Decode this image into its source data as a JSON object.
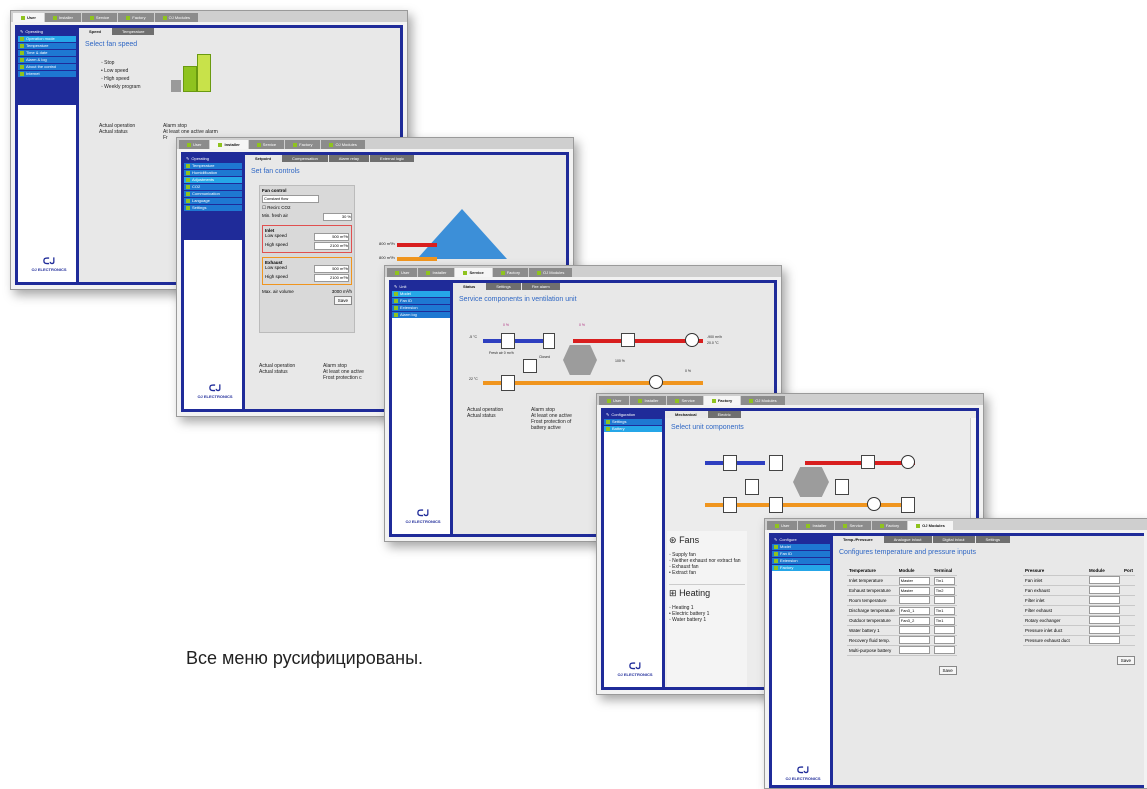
{
  "caption": "Все меню русифицированы.",
  "tabs": [
    "User",
    "Installer",
    "Service",
    "Factory",
    "OJ Modules"
  ],
  "logo": "OJ ELECTRONICS",
  "w1": {
    "side_header": "Operating",
    "side_items": [
      "Operation mode",
      "Temperature",
      "Time & date",
      "Alarm & log",
      "About the control",
      "Internet"
    ],
    "subtabs": [
      "Speed",
      "Temperature"
    ],
    "title": "Select fan speed",
    "options": [
      "Stop",
      "Low speed",
      "High speed",
      "Weekly program"
    ],
    "status_labels": [
      "Actual operation",
      "Actual status"
    ],
    "status_values": [
      "Alarm stop",
      "At least one active alarm",
      "Fr"
    ]
  },
  "w2": {
    "side_header": "Operating",
    "side_items": [
      "Temperature",
      "Humidification",
      "Adjustments",
      "CO2",
      "Communication",
      "Language",
      "Settings"
    ],
    "subtabs": [
      "Setpoint",
      "Compensation",
      "Alarm relay",
      "External logic"
    ],
    "title": "Set fan controls",
    "fan_control": "Fan control",
    "mode": "Constant flow",
    "recirc": "Recirc CO2",
    "min_fresh": "Min. fresh air",
    "min_fresh_val": "30 %",
    "inlet": "Inlet",
    "exhaust": "Exhaust",
    "low": "Low speed",
    "high": "High speed",
    "inlet_low": "500 m³/h",
    "inlet_high": "2100 m³/h",
    "exh_low": "500 m³/h",
    "exh_high": "2100 m³/h",
    "max_vol": "Max. air volume",
    "max_vol_val": "3000 m³/h",
    "save": "Save",
    "flow1": "800 m³/h",
    "flow2": "800 m³/h",
    "status_labels": [
      "Actual operation",
      "Actual status"
    ],
    "status_values": [
      "Alarm stop",
      "At least one active",
      "Frost protection c"
    ]
  },
  "w3": {
    "side_header": "Unit",
    "side_items": [
      "Model",
      "Fan ID",
      "Extension",
      "Alarm log"
    ],
    "subtabs": [
      "Status",
      "Settings",
      "Fire alarm"
    ],
    "title": "Service components in ventilation unit",
    "status_labels": [
      "Actual operation",
      "Actual status"
    ],
    "status_values": [
      "Alarm stop",
      "At least one active",
      "Frost protection of",
      "battery active"
    ],
    "labels": {
      "t1": "-5 °C",
      "t2": "22 °C",
      "pct1": "0 %",
      "pct2": "0 %",
      "pct3": "100 %",
      "pct4": "0 %",
      "fresh": "Fresh air 0 m³/h",
      "closed": "Closed",
      "outflow": "-900 m³/h",
      "outtemp": "20.0 °C"
    }
  },
  "w4": {
    "side_header": "Configuration",
    "side_items": [
      "Settings",
      "Battery"
    ],
    "subtabs": [
      "Mechanical",
      "Electric"
    ],
    "title": "Select unit components",
    "fans_head": "Fans",
    "fans": [
      "Supply fan",
      "Neither exhaust nor extract fan",
      "Exhaust fan",
      "Extract fan"
    ],
    "heating_head": "Heating",
    "heating": [
      "Heating 1",
      "Electric battery 1",
      "Water battery 1"
    ]
  },
  "w5": {
    "side_header": "Configure",
    "side_items": [
      "Model",
      "Fan ID",
      "Extension",
      "Factory"
    ],
    "subtabs": [
      "Temp./Pressure",
      "Analogue in/out",
      "Digital in/out",
      "Settings"
    ],
    "title": "Configures temperature and pressure inputs",
    "col_headers": [
      "Temperature",
      "Module",
      "Terminal"
    ],
    "rows": [
      {
        "name": "Inlet temperature",
        "module": "Master",
        "terminal": "Tin1"
      },
      {
        "name": "Exhaust temperature",
        "module": "Master",
        "terminal": "Tin2"
      },
      {
        "name": "Room temperature",
        "module": "",
        "terminal": ""
      },
      {
        "name": "Discharge temperature",
        "module": "Fan3_1",
        "terminal": "Tin1"
      },
      {
        "name": "Outdoor temperature",
        "module": "Fan3_2",
        "terminal": "Tin1"
      },
      {
        "name": "Water battery 1",
        "module": "",
        "terminal": ""
      },
      {
        "name": "Recovery fluid temp.",
        "module": "",
        "terminal": ""
      },
      {
        "name": "Multi-purpose battery",
        "module": "",
        "terminal": ""
      }
    ],
    "p_headers": [
      "Pressure",
      "Module",
      "Port"
    ],
    "p_rows": [
      "Fan inlet",
      "Fan exhaust",
      "Filter inlet",
      "Filter exhaust",
      "Rotary exchanger",
      "Pressure inlet duct",
      "Pressure exhaust duct"
    ],
    "save": "Save"
  }
}
